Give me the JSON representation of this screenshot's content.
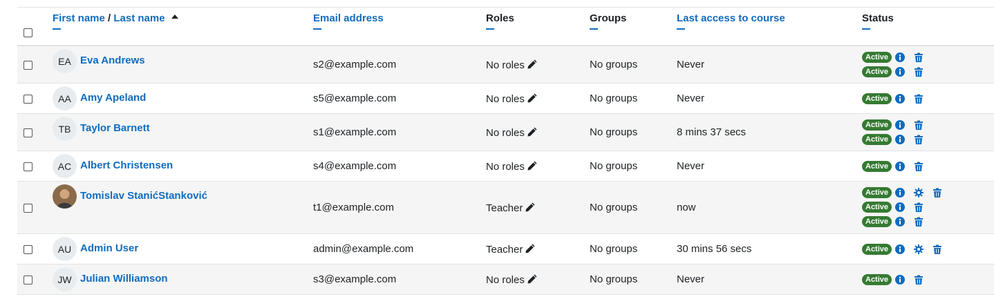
{
  "headers": {
    "name_first": "First name",
    "name_sep": " / ",
    "name_last": "Last name",
    "email": "Email address",
    "roles": "Roles",
    "groups": "Groups",
    "last_access": "Last access to course",
    "status": "Status"
  },
  "rows": [
    {
      "initials": "EA",
      "name": "Eva Andrews",
      "email": "s2@example.com",
      "role": "No roles",
      "groups": "No groups",
      "access": "Never",
      "statuses": [
        {
          "badge": "Active",
          "icons": [
            "info-icon",
            "trash-icon"
          ]
        },
        {
          "badge": "Active",
          "icons": [
            "info-icon",
            "trash-icon"
          ]
        }
      ]
    },
    {
      "initials": "AA",
      "name": "Amy Apeland",
      "email": "s5@example.com",
      "role": "No roles",
      "groups": "No groups",
      "access": "Never",
      "statuses": [
        {
          "badge": "Active",
          "icons": [
            "info-icon",
            "trash-icon"
          ]
        }
      ]
    },
    {
      "initials": "TB",
      "name": "Taylor Barnett",
      "email": "s1@example.com",
      "role": "No roles",
      "groups": "No groups",
      "access": "8 mins 37 secs",
      "statuses": [
        {
          "badge": "Active",
          "icons": [
            "info-icon",
            "trash-icon"
          ]
        },
        {
          "badge": "Active",
          "icons": [
            "info-icon",
            "trash-icon"
          ]
        }
      ]
    },
    {
      "initials": "AC",
      "name": "Albert Christensen",
      "email": "s4@example.com",
      "role": "No roles",
      "groups": "No groups",
      "access": "Never",
      "statuses": [
        {
          "badge": "Active",
          "icons": [
            "info-icon",
            "trash-icon"
          ]
        }
      ]
    },
    {
      "initials": "",
      "name": "Tomislav StanićStanković",
      "email": "t1@example.com",
      "role": "Teacher",
      "groups": "No groups",
      "access": "now",
      "statuses": [
        {
          "badge": "Active",
          "icons": [
            "info-icon",
            "gear-icon",
            "trash-icon"
          ]
        },
        {
          "badge": "Active",
          "icons": [
            "info-icon",
            "trash-icon"
          ]
        },
        {
          "badge": "Active",
          "icons": [
            "info-icon",
            "trash-icon"
          ]
        }
      ]
    },
    {
      "initials": "AU",
      "name": "Admin User",
      "email": "admin@example.com",
      "role": "Teacher",
      "groups": "No groups",
      "access": "30 mins 56 secs",
      "statuses": [
        {
          "badge": "Active",
          "icons": [
            "info-icon",
            "gear-icon",
            "trash-icon"
          ]
        }
      ]
    },
    {
      "initials": "JW",
      "name": "Julian Williamson",
      "email": "s3@example.com",
      "role": "No roles",
      "groups": "No groups",
      "access": "Never",
      "statuses": [
        {
          "badge": "Active",
          "icons": [
            "info-icon",
            "trash-icon"
          ]
        }
      ]
    }
  ],
  "colors": {
    "link": "#0f6cbf",
    "badge": "#357a32",
    "stripe": "#f5f5f5",
    "border": "#dee2e6"
  }
}
